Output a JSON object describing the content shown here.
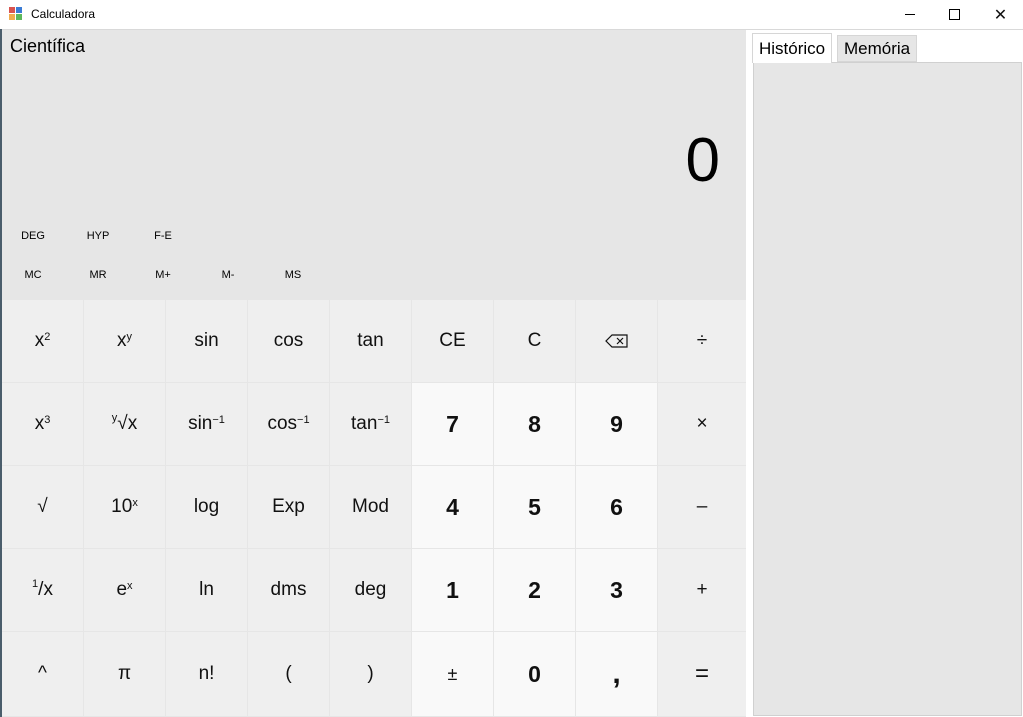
{
  "window": {
    "title": "Calculadora",
    "controls": {
      "minimize": "minimize",
      "maximize": "maximize",
      "close": "✕"
    }
  },
  "calculator": {
    "mode": "Científica",
    "display": "0",
    "angle_row": [
      "DEG",
      "HYP",
      "F-E"
    ],
    "memory_row": [
      "MC",
      "MR",
      "M+",
      "M-",
      "MS"
    ],
    "keys": {
      "square_base": "x",
      "square_exp": "2",
      "power_base": "x",
      "power_exp": "y",
      "sin": "sin",
      "cos": "cos",
      "tan": "tan",
      "ce": "CE",
      "c": "C",
      "backspace": "⌫",
      "divide": "÷",
      "cube_base": "x",
      "cube_exp": "3",
      "root_y_pre": "y",
      "root_y": "√x",
      "asin_base": "sin",
      "asin_exp": "−1",
      "acos_base": "cos",
      "acos_exp": "−1",
      "atan_base": "tan",
      "atan_exp": "−1",
      "seven": "7",
      "eight": "8",
      "nine": "9",
      "multiply": "×",
      "sqrt": "√",
      "ten_pow_base": "10",
      "ten_pow_exp": "x",
      "log": "log",
      "exp": "Exp",
      "mod": "Mod",
      "four": "4",
      "five": "5",
      "six": "6",
      "minus": "–",
      "reciprocal_pre": "1",
      "reciprocal": "/x",
      "e_pow_base": "e",
      "e_pow_exp": "x",
      "ln": "ln",
      "dms": "dms",
      "deg": "deg",
      "one": "1",
      "two": "2",
      "three": "3",
      "plus": "+",
      "caret": "^",
      "pi": "π",
      "factorial": "n!",
      "open_paren": "(",
      "close_paren": ")",
      "plus_minus": "±",
      "zero": "0",
      "decimal": ",",
      "equals": "="
    }
  },
  "side_panel": {
    "tabs": [
      "Histórico",
      "Memória"
    ],
    "active_tab": "Histórico"
  }
}
